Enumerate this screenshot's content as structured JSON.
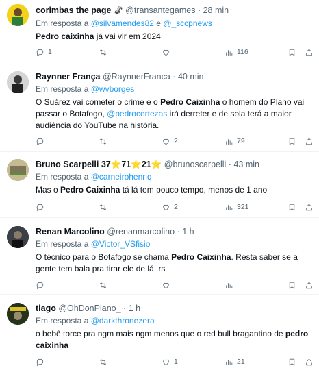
{
  "reply_prefix": "Em resposta a",
  "tweets": [
    {
      "name": "corimbas the page",
      "emoji": "🦨",
      "handle": "@transantegames",
      "time": "28 min",
      "mentions": [
        "@silvamendes82",
        "@_sccpnews"
      ],
      "mention_joiner": "e",
      "text_bold": "Pedro caixinha",
      "text_rest": " já vai vir em 2024",
      "reply_count": "1",
      "retweet_count": "",
      "like_count": "",
      "views": "116",
      "avatar_color": "#f2d21a"
    },
    {
      "name": "Raynner França",
      "handle": "@RaynnerFranca",
      "time": "40 min",
      "mentions": [
        "@wvborges"
      ],
      "text_parts": [
        {
          "t": "O Suárez vai cometer o crime e o ",
          "style": "normal"
        },
        {
          "t": "Pedro Caixinha",
          "style": "bold"
        },
        {
          "t": " o homem do Plano vai passar o Botafogo, ",
          "style": "normal"
        },
        {
          "t": "@pedrocertezas",
          "style": "mention"
        },
        {
          "t": " irá derreter e de sola terá a maior audiência do YouTube na história.",
          "style": "normal"
        }
      ],
      "reply_count": "",
      "retweet_count": "",
      "like_count": "2",
      "views": "79",
      "avatar_color": "#c9c9c9"
    },
    {
      "name": "Bruno Scarpelli 37",
      "badge_a": "71",
      "badge_b": "21",
      "handle": "@brunoscarpelli",
      "time": "43 min",
      "mentions": [
        "@carneirohenriq"
      ],
      "text_parts": [
        {
          "t": "Mas o ",
          "style": "normal"
        },
        {
          "t": "Pedro Caixinha",
          "style": "bold"
        },
        {
          "t": " tá lá tem pouco tempo, menos de 1 ano",
          "style": "normal"
        }
      ],
      "reply_count": "",
      "retweet_count": "",
      "like_count": "2",
      "views": "321",
      "avatar_color": "#b9b08a"
    },
    {
      "name": "Renan Marcolino",
      "handle": "@renanmarcolino",
      "time": "1 h",
      "mentions": [
        "@Victor_VSfisio"
      ],
      "text_parts": [
        {
          "t": "O técnico para o Botafogo se chama ",
          "style": "normal"
        },
        {
          "t": "Pedro Caixinha",
          "style": "bold"
        },
        {
          "t": ". Resta saber se a gente tem bala pra tirar ele de lá. rs",
          "style": "normal"
        }
      ],
      "reply_count": "",
      "retweet_count": "",
      "like_count": "",
      "views": "",
      "avatar_color": "#2b2f33"
    },
    {
      "name": "tiago",
      "handle": "@OhDonPiano_",
      "time": "1 h",
      "mentions": [
        "@darkthronezera"
      ],
      "text_parts": [
        {
          "t": "o bebê torce pra ngm mais ngm menos que o red bull bragantino de ",
          "style": "normal"
        },
        {
          "t": "pedro caixinha",
          "style": "bold"
        }
      ],
      "reply_count": "",
      "retweet_count": "",
      "like_count": "1",
      "views": "21",
      "avatar_color": "#1f2a14"
    }
  ]
}
